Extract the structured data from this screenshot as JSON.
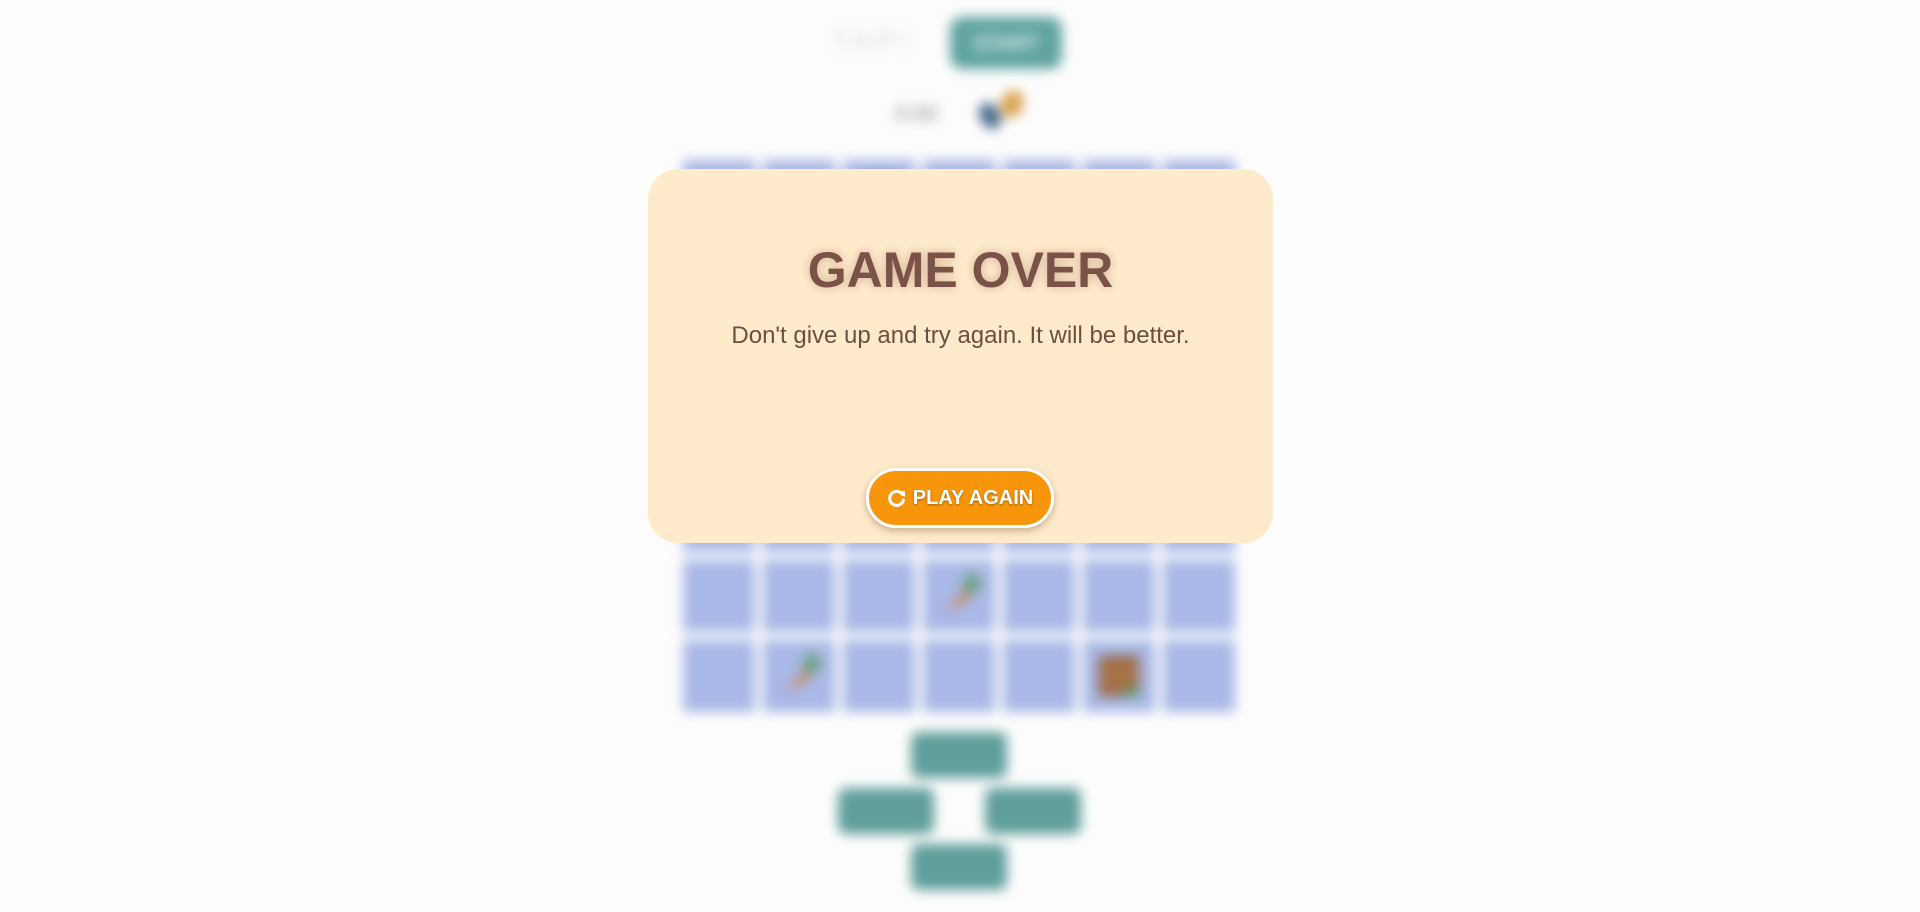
{
  "header": {
    "title": "TAP!",
    "start_label": "START",
    "timer": "0:00"
  },
  "board": {
    "rows": 7,
    "cols": 7,
    "cell_color": "#a9b8e6",
    "items": [
      {
        "row": 0,
        "col": 2,
        "icon": "crate-icon"
      },
      {
        "row": 0,
        "col": 6,
        "icon": "pot-icon"
      },
      {
        "row": 5,
        "col": 3,
        "icon": "carrot-icon"
      },
      {
        "row": 6,
        "col": 1,
        "icon": "carrot-icon"
      },
      {
        "row": 6,
        "col": 5,
        "icon": "crate-icon"
      }
    ]
  },
  "controls": {
    "up": "up-arrow",
    "left": "left-arrow",
    "right": "right-arrow",
    "down": "down-arrow",
    "color": "#5f9e9b"
  },
  "modal": {
    "title": "GAME OVER",
    "message": "Don't give up and try again. It will be better.",
    "button_label": "PLAY AGAIN",
    "button_icon": "refresh-icon",
    "background": "#ffebcc",
    "button_color": "#f7950b",
    "title_color": "#7b5248"
  }
}
